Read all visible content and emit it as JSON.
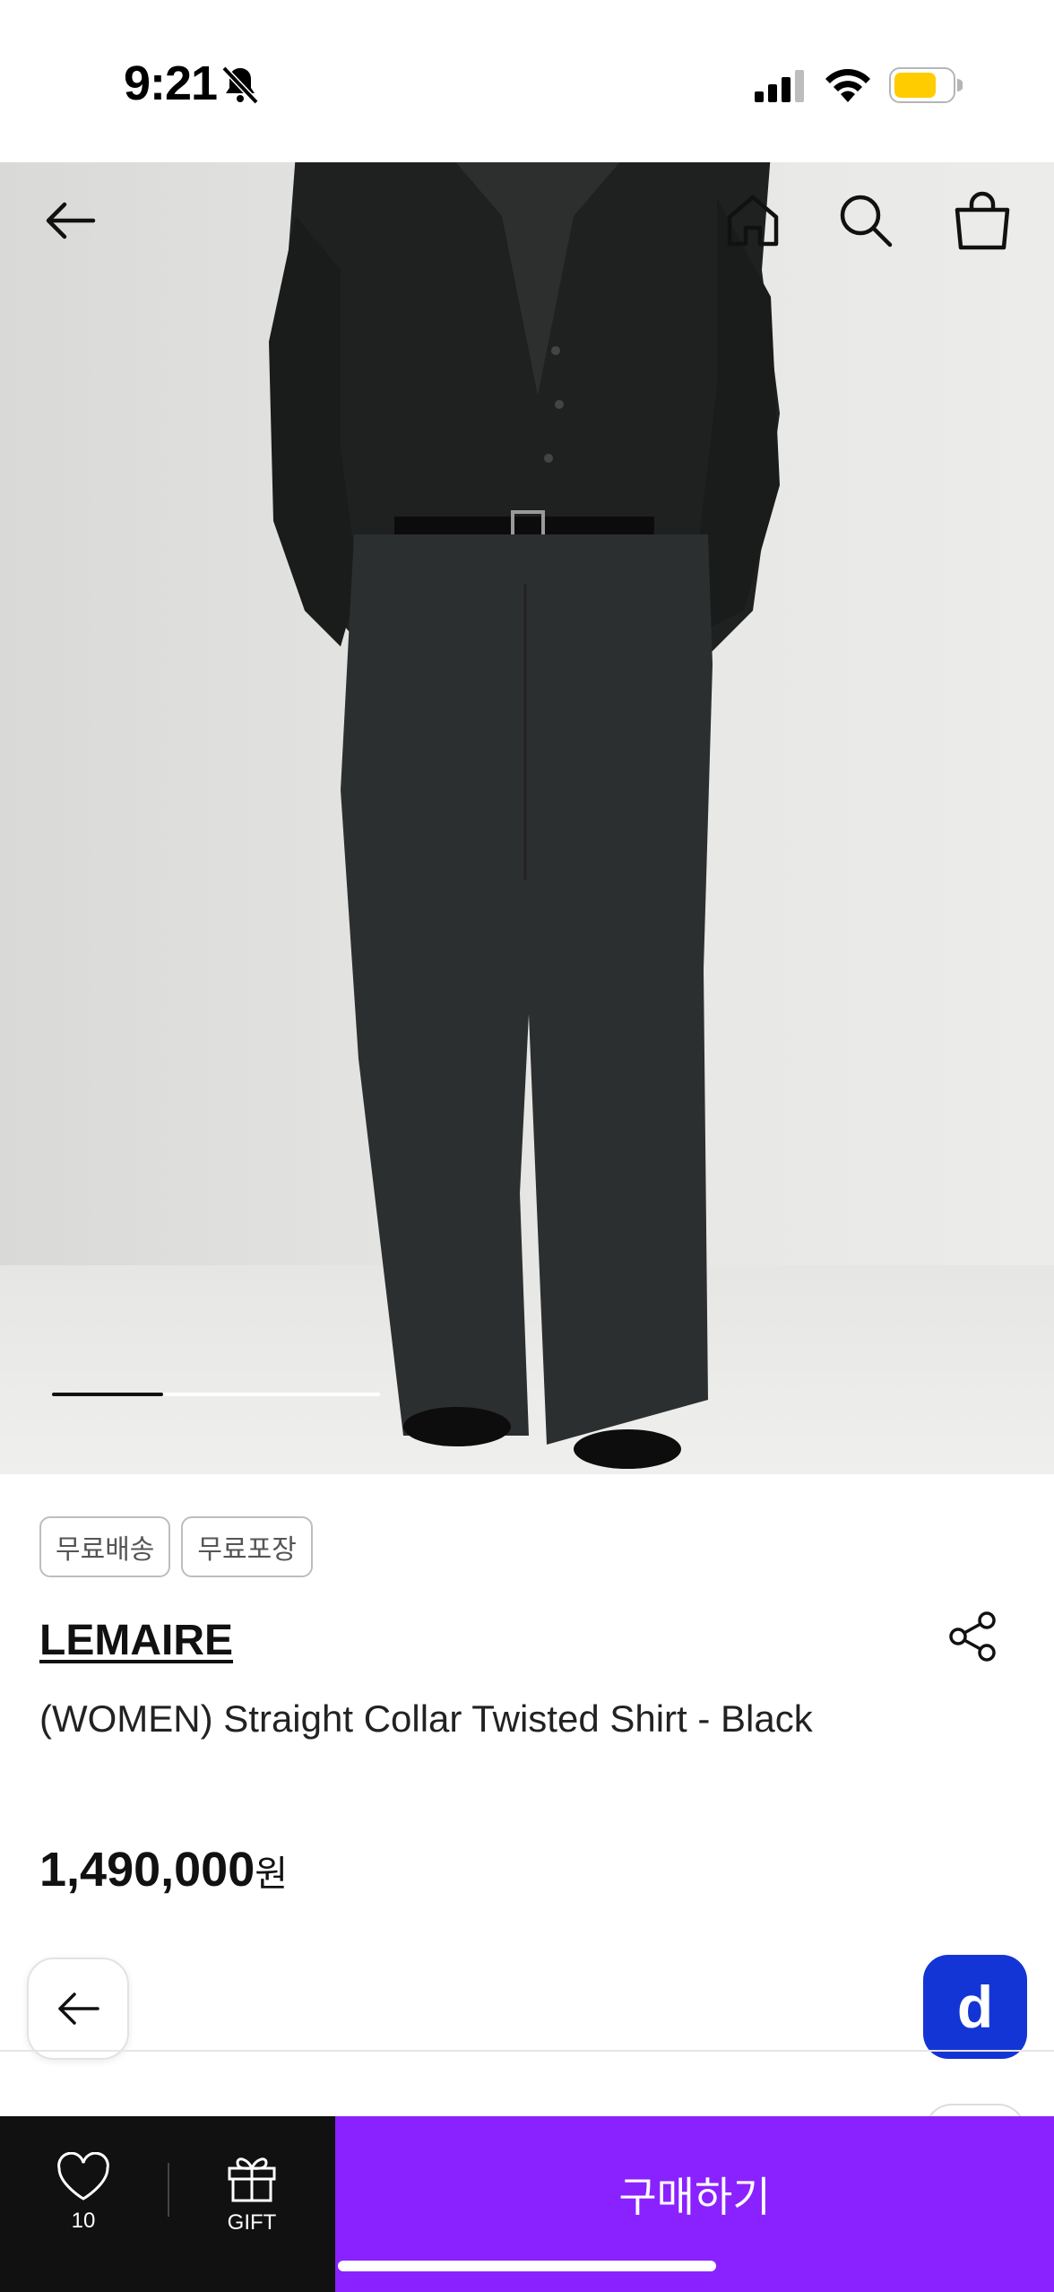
{
  "status_bar": {
    "time": "9:21"
  },
  "nav": {
    "icons": [
      "arrow-left-icon",
      "home-icon",
      "search-icon",
      "shopping-bag-icon"
    ]
  },
  "carousel": {
    "progress": 0.34
  },
  "product": {
    "tags": [
      "무료배송",
      "무료포장"
    ],
    "brand": "LEMAIRE",
    "title": "(WOMEN) Straight Collar Twisted Shirt - Black",
    "price": "1,490,000",
    "price_unit": "원"
  },
  "floating": {
    "d_label": "d"
  },
  "bottom_bar": {
    "like_count": "10",
    "gift_label": "GIFT",
    "buy_label": "구매하기"
  },
  "colors": {
    "buy_button": "#8a22ff",
    "d_button": "#1435d6",
    "battery": "#ffcc00"
  }
}
